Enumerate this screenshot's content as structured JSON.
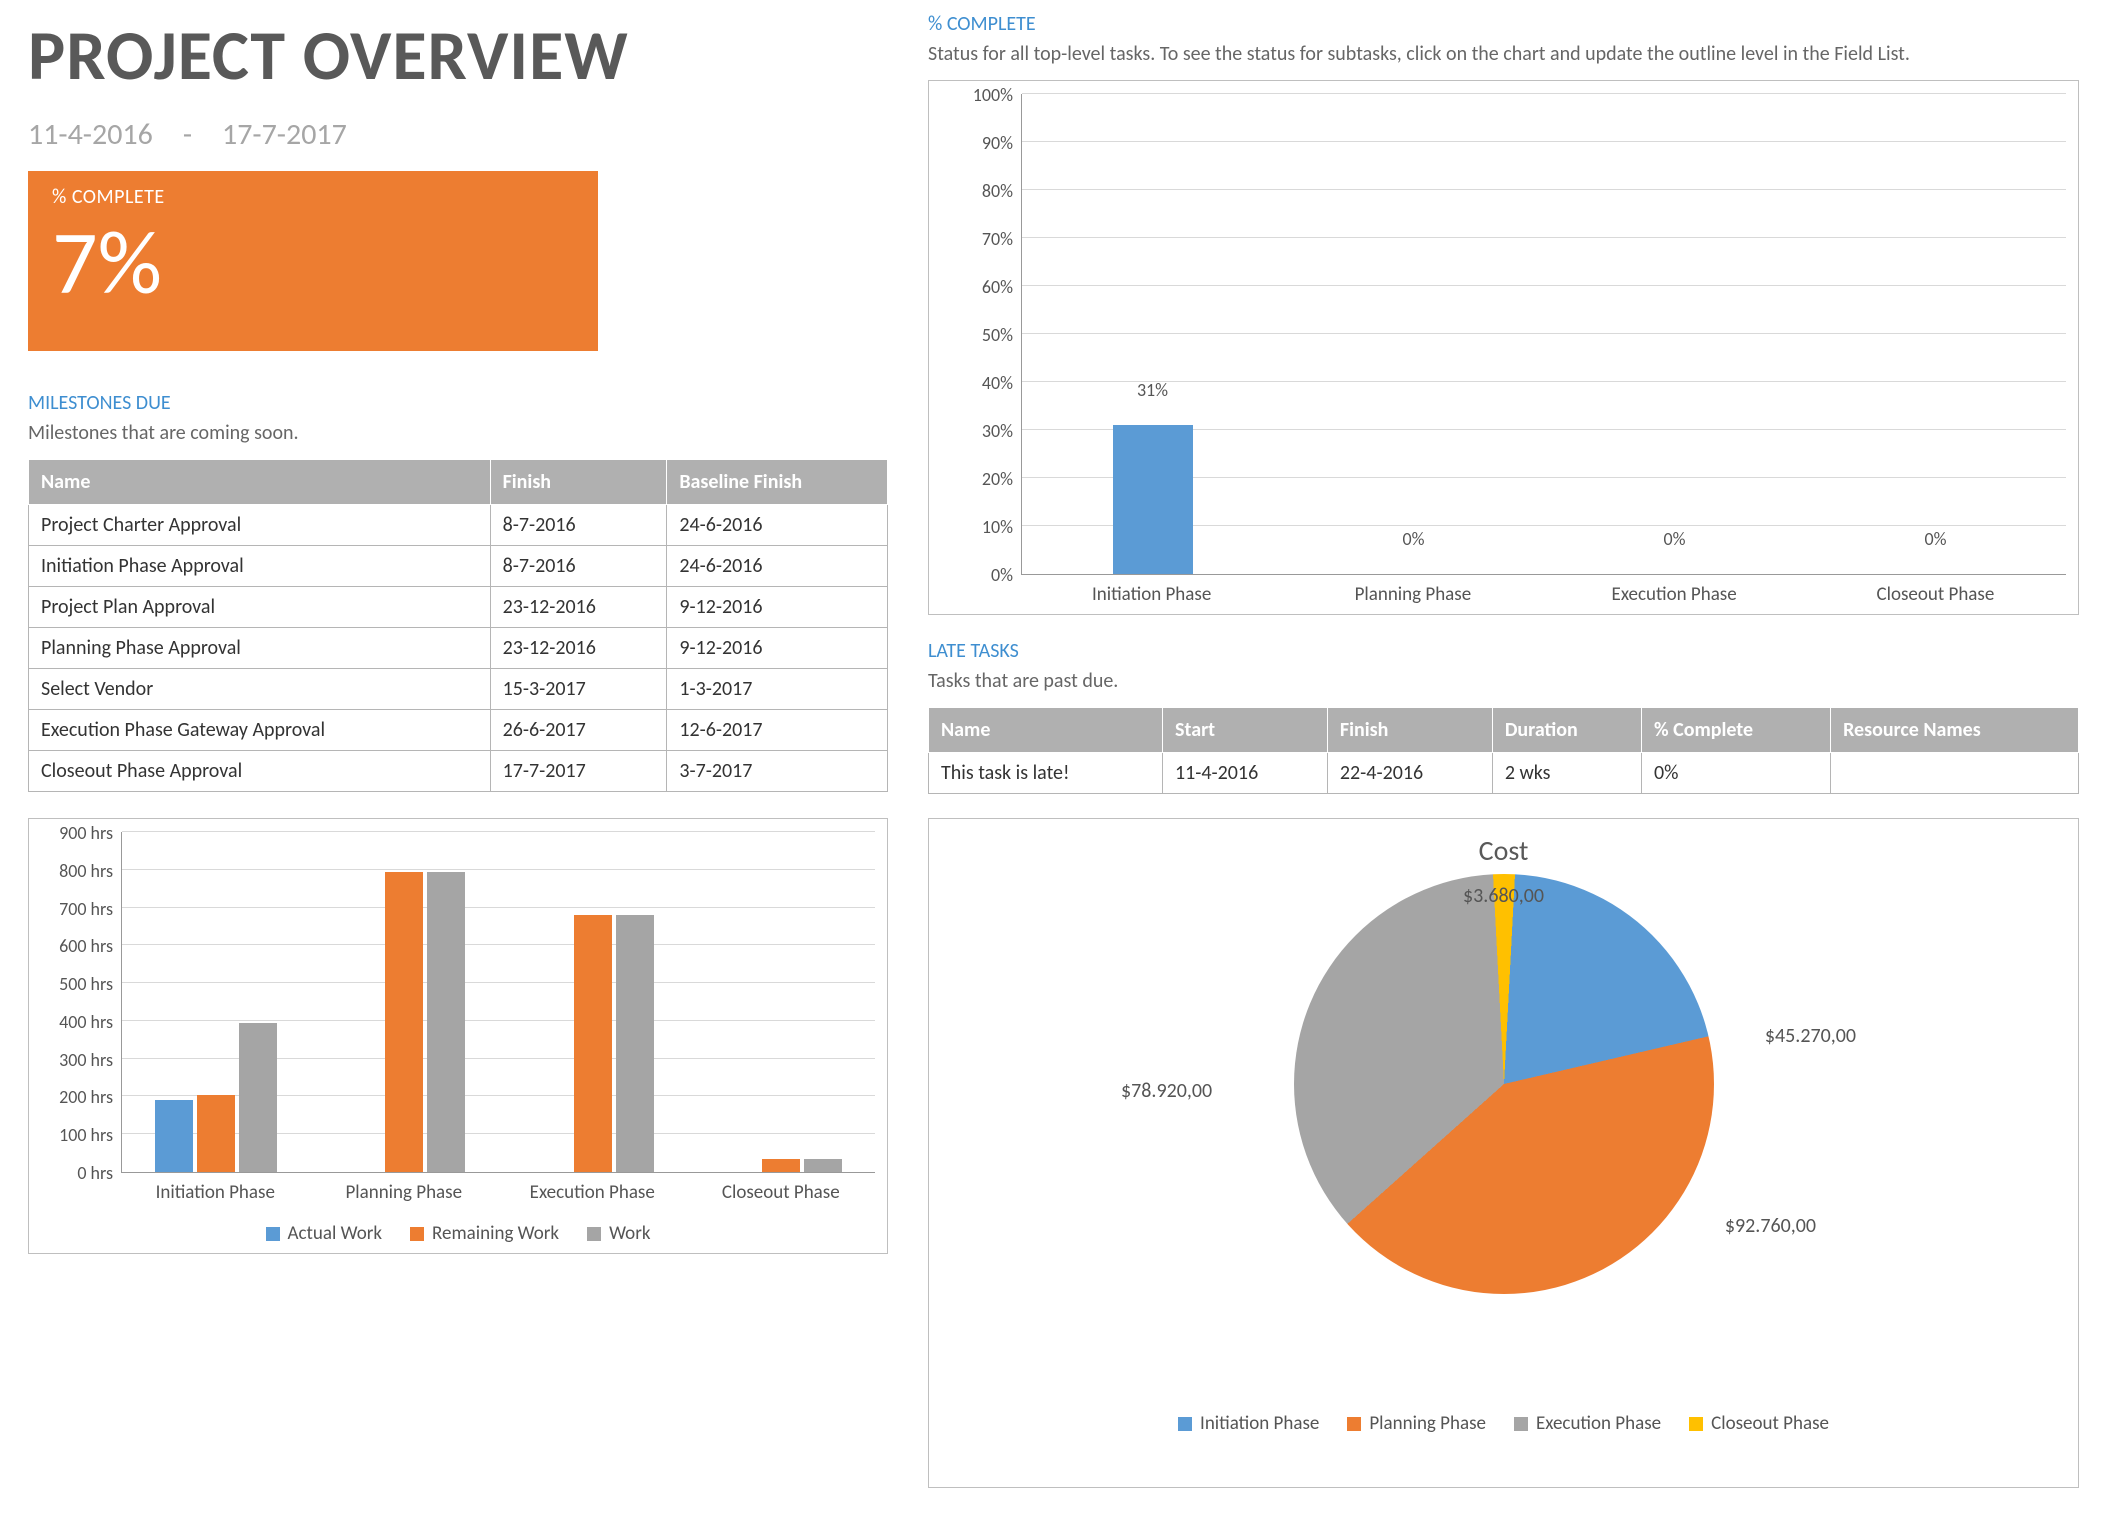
{
  "title": "PROJECT OVERVIEW",
  "dates": {
    "start": "11-4-2016",
    "sep": "-",
    "end": "17-7-2017"
  },
  "complete_tile": {
    "label": "% COMPLETE",
    "value": "7%"
  },
  "milestones": {
    "title": "MILESTONES DUE",
    "sub": "Milestones that are coming soon.",
    "cols": [
      "Name",
      "Finish",
      "Baseline Finish"
    ],
    "rows": [
      [
        "Project Charter Approval",
        "8-7-2016",
        "24-6-2016"
      ],
      [
        "Initiation Phase Approval",
        "8-7-2016",
        "24-6-2016"
      ],
      [
        "Project Plan Approval",
        "23-12-2016",
        "9-12-2016"
      ],
      [
        "Planning Phase Approval",
        "23-12-2016",
        "9-12-2016"
      ],
      [
        "Select Vendor",
        "15-3-2017",
        "1-3-2017"
      ],
      [
        "Execution Phase Gateway Approval",
        "26-6-2017",
        "12-6-2017"
      ],
      [
        "Closeout Phase Approval",
        "17-7-2017",
        "3-7-2017"
      ]
    ]
  },
  "pct_complete_chart_title": "% COMPLETE",
  "pct_complete_chart_sub": "Status for all top-level tasks. To see the status for subtasks, click on the chart and update the outline level in the Field List.",
  "late": {
    "title": "LATE TASKS",
    "sub": "Tasks that are past due.",
    "cols": [
      "Name",
      "Start",
      "Finish",
      "Duration",
      "% Complete",
      "Resource Names"
    ],
    "rows": [
      [
        "This task is late!",
        "11-4-2016",
        "22-4-2016",
        "2 wks",
        "0%",
        ""
      ]
    ]
  },
  "cost_title": "Cost",
  "cost_labels": {
    "init": "$45.270,00",
    "plan": "$92.760,00",
    "exec": "$78.920,00",
    "close": "$3.680,00"
  },
  "legend_names": {
    "init": "Initiation Phase",
    "plan": "Planning Phase",
    "exec": "Execution Phase",
    "close": "Closeout Phase",
    "actual": "Actual Work",
    "remain": "Remaining Work",
    "work": "Work"
  },
  "chart_data": [
    {
      "id": "work_bars",
      "type": "bar",
      "categories": [
        "Initiation Phase",
        "Planning Phase",
        "Execution Phase",
        "Closeout Phase"
      ],
      "series": [
        {
          "name": "Actual Work",
          "values": [
            190,
            0,
            0,
            0
          ],
          "color": "#5b9bd5"
        },
        {
          "name": "Remaining Work",
          "values": [
            205,
            795,
            680,
            35
          ],
          "color": "#ed7d31"
        },
        {
          "name": "Work",
          "values": [
            395,
            795,
            680,
            35
          ],
          "color": "#a5a5a5"
        }
      ],
      "ylabel": "hrs",
      "ylim": [
        0,
        900
      ],
      "ystep": 100,
      "y_tick_format": "{v} hrs"
    },
    {
      "id": "pct_complete",
      "type": "bar",
      "categories": [
        "Initiation Phase",
        "Planning Phase",
        "Execution Phase",
        "Closeout Phase"
      ],
      "series": [
        {
          "name": "% Complete",
          "values": [
            31,
            0,
            0,
            0
          ],
          "color": "#5b9bd5"
        }
      ],
      "data_labels": [
        "31%",
        "0%",
        "0%",
        "0%"
      ],
      "ylim": [
        0,
        100
      ],
      "ystep": 10,
      "y_tick_format": "{v}%"
    },
    {
      "id": "cost_pie",
      "type": "pie",
      "title": "Cost",
      "slices": [
        {
          "name": "Initiation Phase",
          "value": 45270,
          "label": "$45.270,00",
          "color": "#5b9bd5"
        },
        {
          "name": "Planning Phase",
          "value": 92760,
          "label": "$92.760,00",
          "color": "#ed7d31"
        },
        {
          "name": "Execution Phase",
          "value": 78920,
          "label": "$78.920,00",
          "color": "#a5a5a5"
        },
        {
          "name": "Closeout Phase",
          "value": 3680,
          "label": "$3.680,00",
          "color": "#ffc000"
        }
      ]
    }
  ]
}
